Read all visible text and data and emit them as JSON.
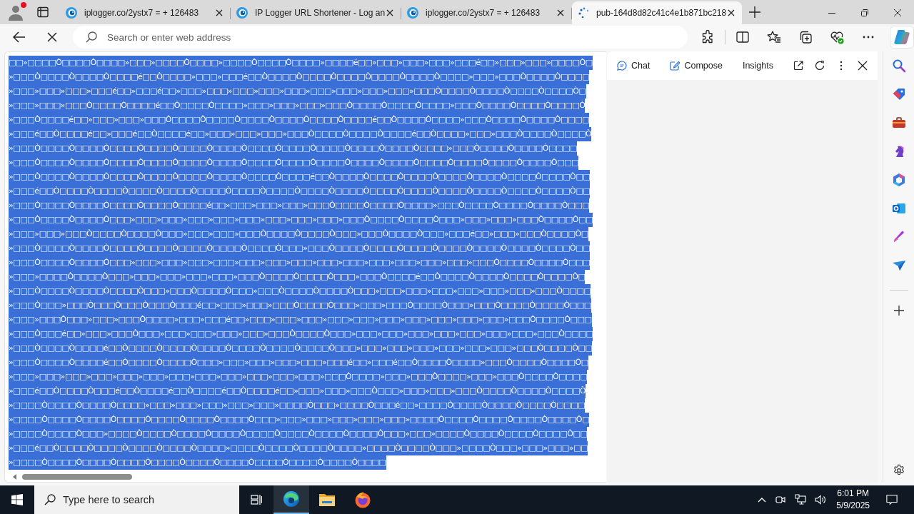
{
  "tab_strip": {
    "tabs": [
      {
        "title": "iplogger.co/2ystx7 = + 126483",
        "selected": false,
        "loading": false
      },
      {
        "title": "IP Logger URL Shortener - Log an",
        "selected": false,
        "loading": false
      },
      {
        "title": "iplogger.co/2ystx7 = + 126483",
        "selected": false,
        "loading": false
      },
      {
        "title": "pub-164d8d82c41c4e1b871bc218",
        "selected": true,
        "loading": true
      }
    ]
  },
  "toolbar": {
    "address_bar": {
      "placeholder": "Search or enter web address"
    }
  },
  "page": {
    "lines": [
      {
        "text": "□□»□□□□Ò□□□□Ò□□□□»□□□»□□□□Ò□□□□»□□□□Ò□□□□Ò□□□□»□□□□é□□»□□□»□□□»□□□»□□□é□□»□□□»□□□»□□□□Ò□",
        "selected": true
      },
      {
        "text": "»□□□Ò□□□□Ò□□□□Ò□□□□é□□Ò□□□□»□□□»□□□é□□Ò□□□□Ò□□□□Ò□□□□Ò□□□□Ò□□□□Ò□□□□»□□□»□□□Ò□□□□Ò□□□□",
        "selected": true
      },
      {
        "text": "»□□□»□□□»□□□»□□□é□□»□□□é□□»□□□»□□□»□□□»□□□»□□□»□□□»□□□»□□□»□□□»□□□Ò□□□□Ò□□□□Ò□□□□Ò□□□□Ò□",
        "selected": true
      },
      {
        "text": "»□□□»□□□»□□□Ò□□□□Ò□□□□é□□Ò□□□□Ò□□□□»□□□»□□□»□□□»□□□Ò□□□□Ò□□□□Ò□□□□»□□□Ò□□□□Ò□□□□Ò□□□□Ò",
        "selected": true
      },
      {
        "text": "»□□□Ò□□□□é□□»□□□»□□□»□□□Ò□□□□Ò□□□□Ò□□□□Ò□□□□Ò□□□□Ò□□□□é□□Ò□□□□Ò□□□□»□□□Ò□□□□Ò□□□□Ò□□□□",
        "selected": true
      },
      {
        "text": "»□□□é□□Ò□□□□é□□»□□□é□□Ò□□□□é□□»□□□»□□□»□□□»□□□Ò□□□□Ò□□□□Ò□□□□é□□Ò□□□□»□□□»□□□Ò□□□□Ò□□□□Ò",
        "selected": true
      },
      {
        "text": "»□□□Ò□□□□Ò□□□□Ò□□□□Ò□□□□Ò□□□□Ò□□□□Ò□□□□Ò□□□□Ò□□□□Ò□□□□Ò□□□□Ò□□□□»□□□Ò□□□□Ò□□□□Ò□□□□",
        "selected": true
      },
      {
        "text": "»□□□Ò□□□□Ò□□□□Ò□□□□Ò□□□□Ò□□□□Ò□□□□Ò□□□□Ò□□□□Ò□□□□Ò□□□□Ò□□□□Ò□□□□Ò□□□□Ò□□□□Ò□□□□Ò□□□",
        "selected": true
      },
      {
        "text": "»□□□Ò□□□□Ò□□□□Ò□□□□Ò□□□□Ò□□□□Ò□□□□Ò□□□□Ò□□□□é□□Ò□□□□Ò□□□□Ò□□□□Ò□□□□Ò□□□□Ò□□□□Ò□□□□Ò□□",
        "selected": true
      },
      {
        "text": "»□□□é□□Ò□□□□Ò□□□□Ò□□□□Ò□□□□Ò□□□□Ò□□□□Ò□□□□Ò□□□□Ò□□□□Ò□□□□Ò□□□□Ò□□□□Ò□□□□Ò□□□□Ò□□□□Ò□□",
        "selected": true
      },
      {
        "text": "»□□□Ò□□□□Ò□□□□Ò□□□□Ò□□□□Ò□□□□é□□»□□□»□□□»□□□»□□□Ò□□□□Ò□□□□Ò□□□□»□□□Ò□□□□Ò□□□□Ò□□□□Ò□□□",
        "selected": true
      },
      {
        "text": "»□□□Ò□□□□Ò□□□□Ò□□□»□□□»□□□»□□□»□□□»□□□»□□□»□□□»□□□»□□□Ò□□□□Ò□□□□Ò□□□»□□□»□□□»□□□Ò□□□□Ò□□",
        "selected": true
      },
      {
        "text": "»□□□»□□□»□□□Ò□□□□Ò□□□□Ò□□□»□□□»□□□»□□□Ò□□□□Ò□□□□Ò□□□»□□□Ò□□□□Ò□□□»□□□é□□»□□□»□□□Ò□□□□Ò□",
        "selected": true
      },
      {
        "text": "»□□□Ò□□□□Ò□□□□Ò□□□□Ò□□□□Ò□□□□Ò□□□□Ò□□□□Ò□□□»□□□Ò□□□□Ò□□□□Ò□□□□Ò□□□□Ò□□□□Ò□□□□Ò□□□□Ò□□",
        "selected": true
      },
      {
        "text": "»□□□Ò□□□□Ò□□□□Ò□□□»□□□»□□□»□□□»□□□»□□□»□□□»□□□»□□□»□□□»□□□»□□□»□□□»□□□»□□□Ò□□□□Ò□□□□Ò□□□",
        "selected": true
      },
      {
        "text": "»□□□»□□□□Ò□□□□Ò□□□»□□□»□□□»□□□»□□□»□□□Ò□□□□Ò□□□□Ò□□□»□□□Ò□□□□é□□Ò□□□□Ò□□□□Ò□□□□Ò□□□□Ò□",
        "selected": true
      },
      {
        "text": "»□□□Ò□□□□Ò□□□□Ò□□□□Ò□□□»□□□Ò□□□□Ò□□□»□□□Ò□□□□Ò□□□□Ò□□□»□□□»□□□»□□□»□□□»□□□»□□□»□□□Ò□□□□",
        "selected": true
      },
      {
        "text": "»□□□Ò□□□»□□□Ò□□□Ò□□□Ò□□□Ò□□□é□□»□□□»□□□»□□□Ò□□□□Ò□□□»□□□»□□□Ò□□□□Ò□□□»□□□Ò□□□□Ò□□□□Ò□□□",
        "selected": true
      },
      {
        "text": "»□□□»□□□Ò□□□»□□□»□□□Ò□□□□»□□□»□□□é□□»□□□»□□□»□□□»□□□»□□□»□□□»□□□»□□□»□□□»□□□»□□□Ò□□□□Ò□□□",
        "selected": true
      },
      {
        "text": "»□□□Ò□□□é□□»□□□»□□□Ò□□□»□□□»□□□»□□□»□□□»□□□Ò□□□□Ò□□□»□□□»□□□»□□□»□□□»□□□»□□□»□□□»□□□Ò□□□□",
        "selected": true
      },
      {
        "text": "»□□□Ò□□□□Ò□□□□é□□Ò□□□□Ò□□□□Ò□□□□Ò□□□□Ò□□□□Ò□□□□Ò□□□»□□□»□□□»□□□»□□□»□□□»□□□»□□□Ò□□□□Ò□□",
        "selected": true
      },
      {
        "text": "»□□□Ò□□□□Ò□□□□é□□Ò□□□□Ò□□□□Ò□□□»□□□»□□□»□□□»□□□»□□□é□□»□□□é□□Ò□□□□Ò□□□□»□□□Ò□□□□Ò□□□□Ò□",
        "selected": true
      },
      {
        "text": "»□□□»□□□»□□□»□□□»□□□»□□□»□□□»□□□»□□□»□□□»□□□»□□□»□□□Ò□□□□»□□□»□□□Ò□□□□»□□□»□□□Ò□□□□Ò□□□□",
        "selected": true
      },
      {
        "text": "»□□□é□□Ò□□□□Ò□□□é□□Ò□□□□é□□Ò□□□□é□□Ò□□□□é□□»□□□»□□□»□□□Ò□□□»□□□»□□□»□□□Ò□□□□Ò□□□□Ò□□□□Ò",
        "selected": true
      },
      {
        "text": "»□□□□Ò□□□□Ò□□□□Ò□□□□»□□□»□□□»□□□»□□□»□□□»□□□□Ò□□□»□□□□Ò□□□é□□»□□□□Ò□□□□Ò□□□□Ò□□□□Ò□□□□",
        "selected": true
      },
      {
        "text": "»□□□□Ò□□□□Ò□□□□Ò□□□□Ò□□□□Ò□□□□Ò□□□□Ò□□□»□□□»□□□»□□□»□□□»□□□»□□□□Ò□□□□Ò□□□□Ò□□□□Ò□□□□Ò□",
        "selected": true
      },
      {
        "text": "»□□□□Ò□□□□Ò□□□»□□□□Ò□□□□Ò□□□□Ò□□□□Ò□□□□Ò□□□□Ò□□□□Ò□□□□Ò□□□»□□□»□□□□Ò□□□□Ò□□□□Ò□□□□Ò□□",
        "selected": true
      },
      {
        "text": "»□□□é□□Ò□□□□Ò□□□□Ò□□□□Ò□□□□Ò□□□□»□□□□Ò□□□□Ò□□□□Ò□□□□»□□□□Ò□□□□Ò□□□»□□□□Ò□□□»□□□»□□□»□□",
        "selected": true
      },
      {
        "text": "»□□□□Ò□□□□Ò□□□□Ò□□□□Ò□□□□Ò□□□□Ò□□□□Ò□□□□Ò□□□□Ò□□□□Ò□□□□",
        "selected": true
      }
    ]
  },
  "copilot_pane": {
    "tabs": [
      "Chat",
      "Compose",
      "Insights"
    ]
  },
  "taskbar": {
    "search": {
      "placeholder": "Type here to search"
    },
    "apps": [
      {
        "kind": "edge",
        "selected": true
      },
      {
        "kind": "explorer",
        "selected": false
      },
      {
        "kind": "firefox",
        "selected": false
      }
    ],
    "clock": {
      "time": "6:01 PM",
      "date": "5/9/2025"
    }
  }
}
